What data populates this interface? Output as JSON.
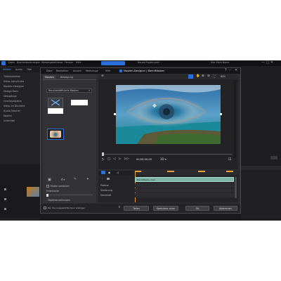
{
  "app": {
    "menu": [
      "Datei",
      "Bearbeiten",
      "Anzeigen",
      "Wiedergabe",
      "Extras",
      "Fenster",
      "Hilfe"
    ],
    "status_title": "Neues Projekt.pds*",
    "user": "Hier Mein Name",
    "sidebar_tabs": [
      "Medien",
      "Audio",
      "Titel"
    ],
    "sidebar_items": [
      "Titelbibliothek",
      "Video-Intro/Outro",
      "Masken-Designer",
      "Design-Tools",
      "Übergänge",
      "Overlayobjekte",
      "Video im Blickfeld",
      "Audio-Mischer",
      "Kapitel",
      "Untertitel"
    ],
    "accent": "#2a6fdb"
  },
  "dialog": {
    "menu": [
      "Datei",
      "Bearbeiten",
      "Ansicht",
      "Werkzeuge",
      "Hilfe"
    ],
    "title": "Masken-Designer | BlendMasken",
    "tabs": [
      "Masken",
      "Bewegung"
    ],
    "mask_dropdown": "Benutzerdefinierte Masken",
    "checkbox_label": "Maske umkehren",
    "feather_label": "Federkante",
    "section_label": "Objekteinstellungen",
    "zoom_value": "80%",
    "timecode": "00;00;00;00",
    "track_clip_label": "BlendMaske.mp4",
    "track_rows": [
      "Position",
      "Skalierung",
      "Deckkraft"
    ],
    "bottom_checkbox": "Nur die ausgewählte Spur anzeigen",
    "buttons": {
      "share": "Teilen",
      "save_as": "Speichern unter",
      "ok": "OK",
      "cancel": "Abbrechen"
    }
  }
}
